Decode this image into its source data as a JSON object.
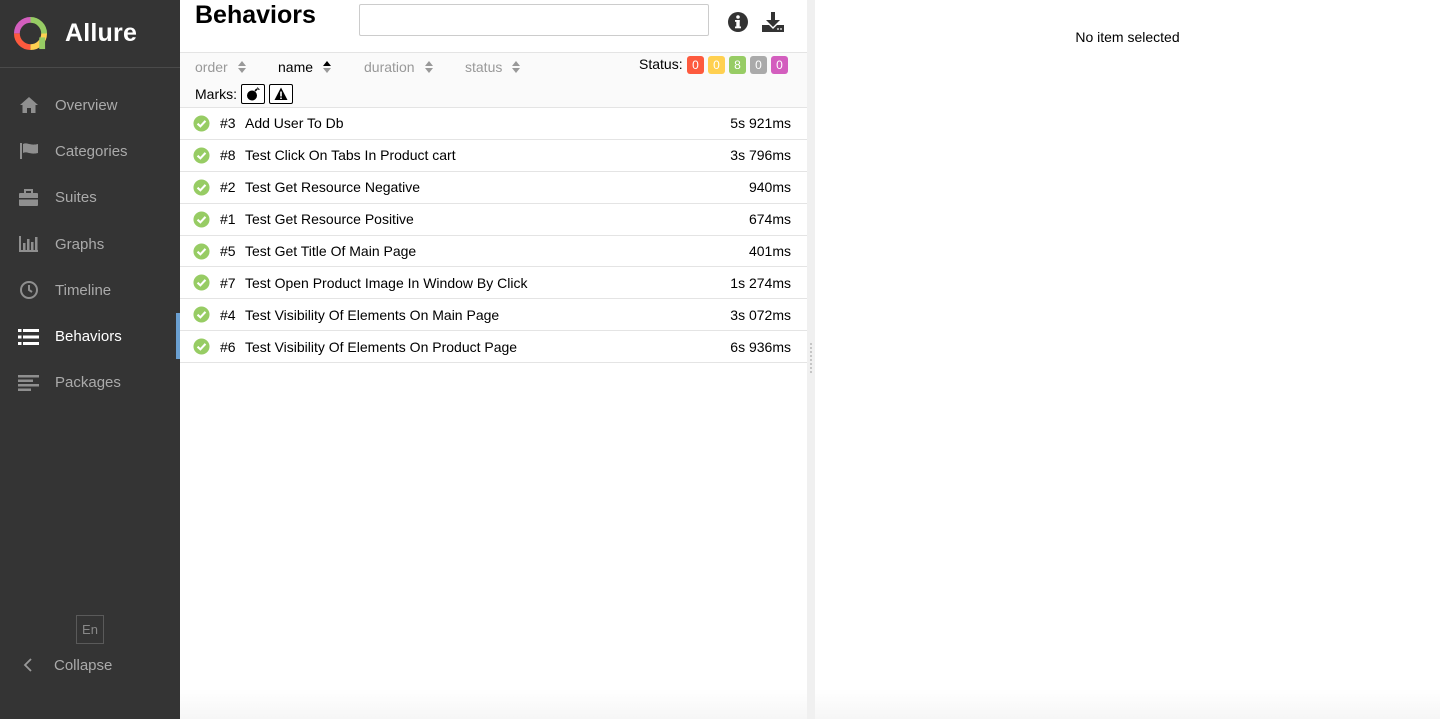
{
  "app": {
    "brand": "Allure"
  },
  "sidebar": {
    "items": [
      {
        "label": "Overview",
        "icon": "home-icon"
      },
      {
        "label": "Categories",
        "icon": "flag-icon"
      },
      {
        "label": "Suites",
        "icon": "briefcase-icon"
      },
      {
        "label": "Graphs",
        "icon": "bar-chart-icon"
      },
      {
        "label": "Timeline",
        "icon": "clock-icon"
      },
      {
        "label": "Behaviors",
        "icon": "list-icon",
        "active": true
      },
      {
        "label": "Packages",
        "icon": "align-left-icon"
      }
    ],
    "language": "En",
    "collapse": "Collapse"
  },
  "header": {
    "title": "Behaviors",
    "search": {
      "value": "",
      "placeholder": ""
    }
  },
  "toolbar": {
    "sorters": [
      {
        "label": "order",
        "active": false
      },
      {
        "label": "name",
        "active": true
      },
      {
        "label": "duration",
        "active": false
      },
      {
        "label": "status",
        "active": false
      }
    ],
    "status_label": "Status:",
    "status_counts": [
      {
        "status": "failed",
        "count": "0",
        "color": "#fd5a3e"
      },
      {
        "status": "broken",
        "count": "0",
        "color": "#ffd050"
      },
      {
        "status": "passed",
        "count": "8",
        "color": "#97cc64"
      },
      {
        "status": "skipped",
        "count": "0",
        "color": "#aaaaaa"
      },
      {
        "status": "unknown",
        "count": "0",
        "color": "#d35ebe"
      }
    ],
    "marks_label": "Marks:",
    "marks": [
      "flaky-bomb-icon",
      "new-failed-warning-icon"
    ]
  },
  "tests": [
    {
      "order": "#3",
      "name": "Add User To Db",
      "duration": "5s 921ms",
      "status": "passed"
    },
    {
      "order": "#8",
      "name": "Test Click On Tabs In Product cart",
      "duration": "3s 796ms",
      "status": "passed"
    },
    {
      "order": "#2",
      "name": "Test Get Resource Negative",
      "duration": "940ms",
      "status": "passed"
    },
    {
      "order": "#1",
      "name": "Test Get Resource Positive",
      "duration": "674ms",
      "status": "passed"
    },
    {
      "order": "#5",
      "name": "Test Get Title Of Main Page",
      "duration": "401ms",
      "status": "passed"
    },
    {
      "order": "#7",
      "name": "Test Open Product Image In Window By Click",
      "duration": "1s 274ms",
      "status": "passed"
    },
    {
      "order": "#4",
      "name": "Test Visibility Of Elements On Main Page",
      "duration": "3s 072ms",
      "status": "passed"
    },
    {
      "order": "#6",
      "name": "Test Visibility Of Elements On Product Page",
      "duration": "6s 936ms",
      "status": "passed"
    }
  ],
  "detail": {
    "empty_text": "No item selected"
  },
  "colors": {
    "sidebar_bg": "#343434",
    "accent": "#6a9fd0",
    "passed": "#97cc64"
  }
}
